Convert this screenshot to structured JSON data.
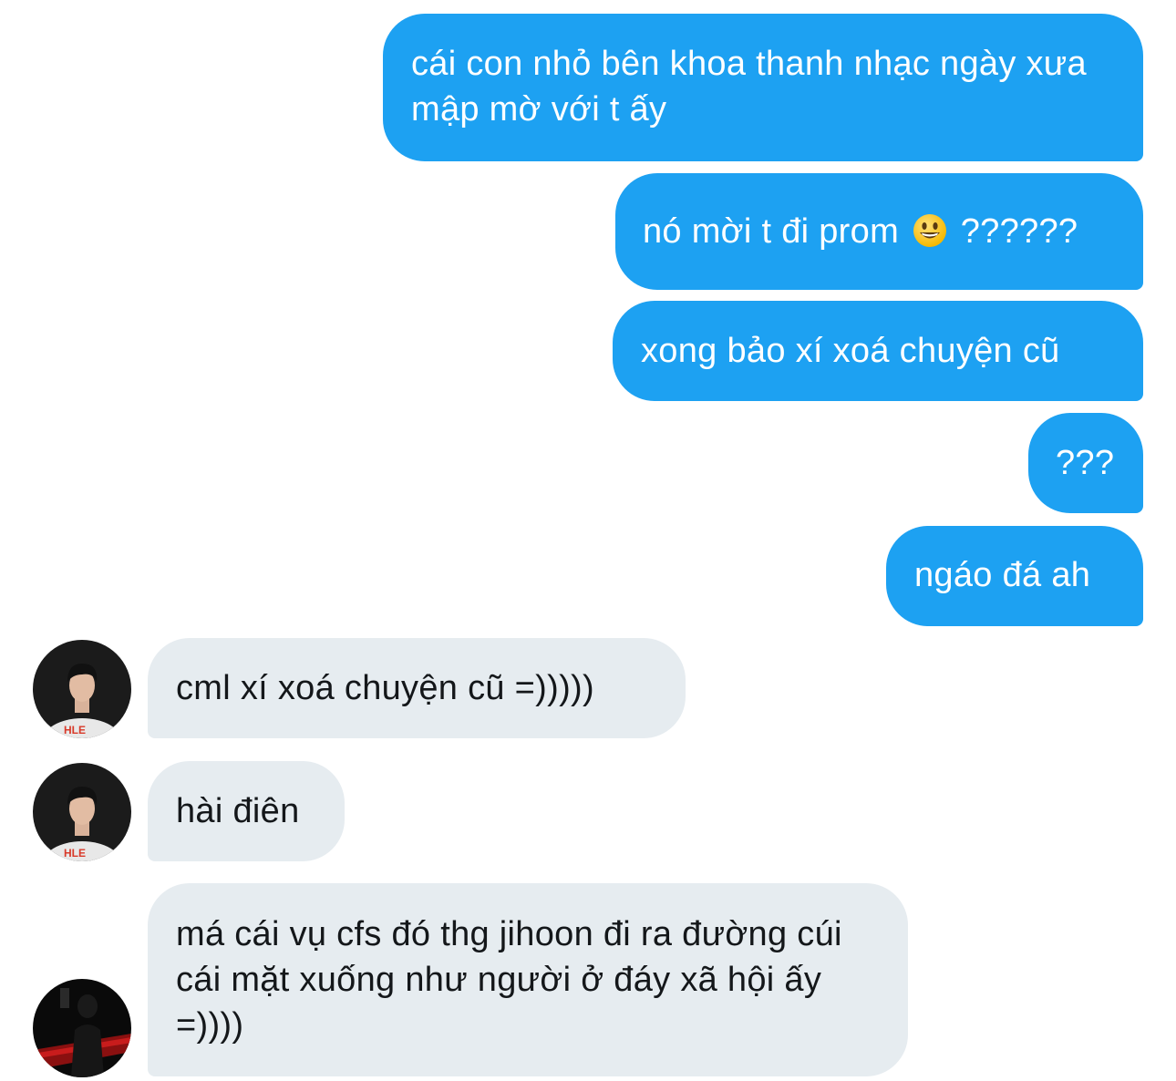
{
  "conversation": {
    "sent": [
      {
        "text": "cái con nhỏ bên khoa thanh nhạc ngày xưa mập mờ với t ấy"
      },
      {
        "text_before": "nó mời t đi prom",
        "emoji": "grinning-face-emoji",
        "text_after": "??????"
      },
      {
        "text": "xong bảo xí xoá chuyện cũ"
      },
      {
        "text": "???"
      },
      {
        "text": "ngáo đá ah"
      }
    ],
    "received": [
      {
        "text": "cml xí xoá chuyện cũ =)))))",
        "avatar": "player-avatar"
      },
      {
        "text": "hài điên",
        "avatar": "player-avatar"
      },
      {
        "text": "má cái vụ cfs đó thg jihoon đi ra đường cúi cái mặt xuống như người ở đáy xã hội ấy =))))",
        "avatar": "dark-silhouette-avatar"
      }
    ],
    "avatar_badge_text": "HLE"
  },
  "colors": {
    "sent_bubble": "#1da1f2",
    "received_bubble": "#e6ecf0",
    "sent_text": "#ffffff",
    "received_text": "#14171a",
    "background": "#ffffff"
  }
}
